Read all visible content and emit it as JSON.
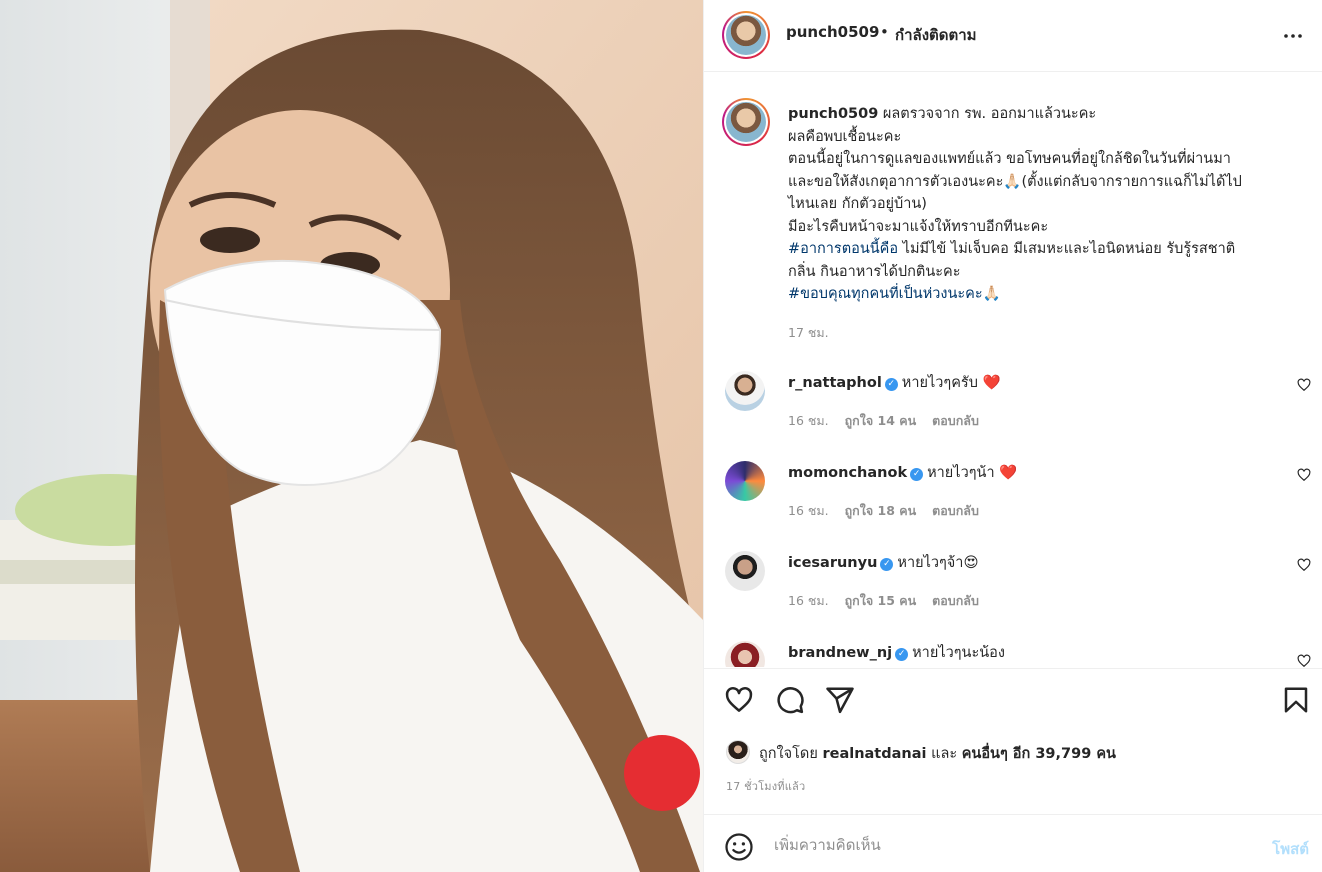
{
  "header": {
    "username": "punch0509",
    "separator": "•",
    "follow_status": "กำลังติดตาม",
    "more_icon": "more-horizontal-icon"
  },
  "caption": {
    "username": "punch0509",
    "line1": "ผลตรวจจาก รพ. ออกมาแล้วนะคะ",
    "line2": "ผลคือพบเชื้อนะคะ",
    "line3": "ตอนนี้อยู่ในการดูแลของแพทย์แล้ว ขอโทษคนที่อยู่ใกล้ชิดในวันที่ผ่านมา",
    "line4": "และขอให้สังเกตุอาการตัวเองนะคะ🙏🏻(ตั้งแต่กลับจากรายการแฉก็ไม่ได้ไป",
    "line5": "ไหนเลย กักตัวอยู่บ้าน)",
    "line6": "มีอะไรคืบหน้าจะมาแจ้งให้ทราบอีกทีนะคะ",
    "hashtag1": "#อาการตอนนี้คือ",
    "line7_rest": " ไม่มีไข้ ไม่เจ็บคอ มีเสมหะและไอนิดหน่อย รับรู้รสชาติ",
    "line8": "กลิ่น กินอาหารได้ปกตินะคะ",
    "hashtag2": "#ขอบคุณทุกคนที่เป็นห่วงนะคะ",
    "hashtag2_emoji": "🙏🏻",
    "time": "17 ชม."
  },
  "comments": [
    {
      "user": "r_nattaphol",
      "text": "หายไวๆครับ",
      "emoji": "❤️",
      "time": "16 ชม.",
      "likes": "ถูกใจ 14 คน",
      "reply": "ตอบกลับ"
    },
    {
      "user": "momonchanok",
      "text": "หายไวๆน้า",
      "emoji": "❤️",
      "time": "16 ชม.",
      "likes": "ถูกใจ 18 คน",
      "reply": "ตอบกลับ"
    },
    {
      "user": "icesarunyu",
      "text": "หายไวๆจ้า",
      "emoji": "😍",
      "time": "16 ชม.",
      "likes": "ถูกใจ 15 คน",
      "reply": "ตอบกลับ"
    },
    {
      "user": "brandnew_nj",
      "text": "หายไวๆนะน้อง",
      "emoji": "",
      "time": "",
      "likes": "",
      "reply": ""
    }
  ],
  "verified_mark": "✓",
  "actions": {
    "like_icon": "heart-icon",
    "comment_icon": "comment-bubble-icon",
    "share_icon": "paper-plane-icon",
    "save_icon": "bookmark-icon"
  },
  "likes": {
    "prefix": "ถูกใจโดย ",
    "user": "realnatdanai",
    "middle": " และ ",
    "others": "คนอื่นๆ อีก 39,799 คน"
  },
  "post_time": "17 ชั่วโมงที่แล้ว",
  "comment_box": {
    "placeholder": "เพิ่มความคิดเห็น",
    "post_label": "โพสต์",
    "emoji_icon": "smiley-icon"
  },
  "colors": {
    "accent_blue": "#0095f6",
    "post_disabled": "#b2dffc",
    "hashtag": "#00376b",
    "muted": "#8e8e8e"
  }
}
